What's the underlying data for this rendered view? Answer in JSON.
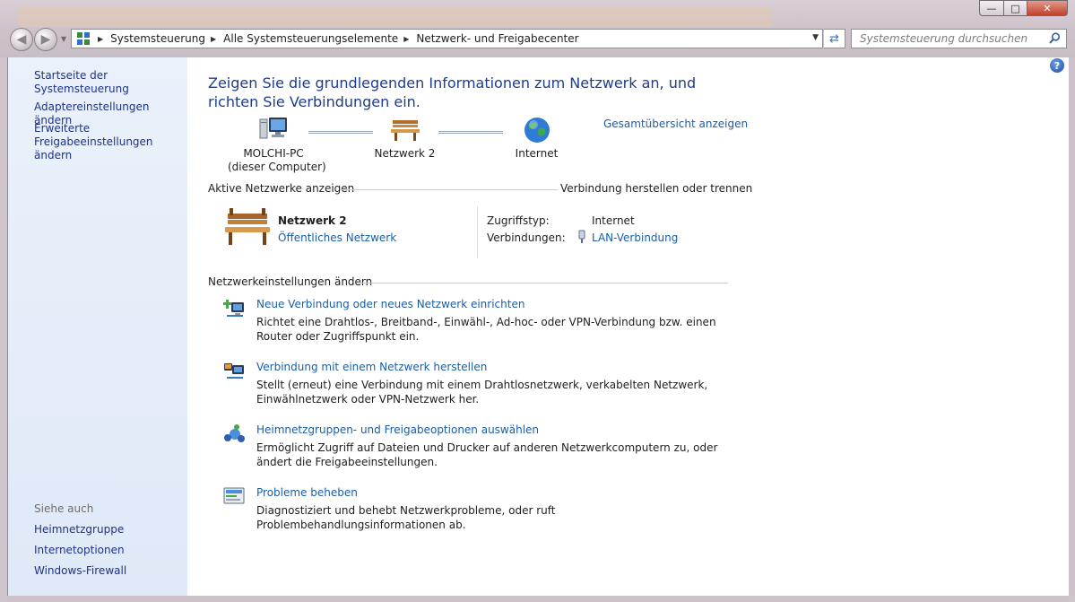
{
  "window": {
    "controls": {
      "minimize": "—",
      "maximize": "□",
      "close": "✕"
    }
  },
  "navigation": {
    "breadcrumbs": [
      "Systemsteuerung",
      "Alle Systemsteuerungselemente",
      "Netzwerk- und Freigabecenter"
    ],
    "search_placeholder": "Systemsteuerung durchsuchen"
  },
  "sidebar": {
    "home": "Startseite der Systemsteuerung",
    "links": [
      "Adaptereinstellungen ändern",
      "Erweiterte Freigabeeinstellungen ändern"
    ],
    "see_also_label": "Siehe auch",
    "see_also": [
      "Heimnetzgruppe",
      "Internetoptionen",
      "Windows-Firewall"
    ]
  },
  "main": {
    "heading": "Zeigen Sie die grundlegenden Informationen zum Netzwerk an, und richten Sie Verbindungen ein.",
    "overview_link": "Gesamtübersicht anzeigen",
    "network_map": {
      "computer_name": "MOLCHI-PC",
      "computer_sub": "(dieser Computer)",
      "network_name": "Netzwerk  2",
      "internet": "Internet"
    },
    "active_networks": {
      "title": "Aktive Netzwerke anzeigen",
      "connect_link": "Verbindung herstellen oder trennen",
      "network_name": "Netzwerk  2",
      "network_type": "Öffentliches Netzwerk",
      "access_type_label": "Zugriffstyp:",
      "access_type_value": "Internet",
      "connections_label": "Verbindungen:",
      "connections_value": "LAN-Verbindung"
    },
    "settings": {
      "title": "Netzwerkeinstellungen ändern",
      "tasks": [
        {
          "title": "Neue Verbindung oder neues Netzwerk einrichten",
          "desc": "Richtet eine Drahtlos-, Breitband-, Einwähl-, Ad-hoc- oder VPN-Verbindung bzw. einen Router oder Zugriffspunkt ein.",
          "icon": "new-connection-icon"
        },
        {
          "title": "Verbindung mit einem Netzwerk herstellen",
          "desc": "Stellt (erneut) eine Verbindung mit einem Drahtlosnetzwerk, verkabelten Netzwerk, Einwählnetzwerk oder VPN-Netzwerk her.",
          "icon": "connect-network-icon"
        },
        {
          "title": "Heimnetzgruppen- und Freigabeoptionen auswählen",
          "desc": "Ermöglicht Zugriff auf Dateien und Drucker auf anderen Netzwerkcomputern zu, oder ändert die Freigabeeinstellungen.",
          "icon": "homegroup-icon"
        },
        {
          "title": "Probleme beheben",
          "desc": "Diagnostiziert und behebt Netzwerkprobleme, oder ruft Problembehandlungsinformationen ab.",
          "icon": "troubleshoot-icon"
        }
      ]
    }
  },
  "colors": {
    "link": "#1a5ea8",
    "sidebar_link": "#1e3287",
    "heading": "#1e3c8c",
    "sidebar_bg": "#e4edf9"
  }
}
